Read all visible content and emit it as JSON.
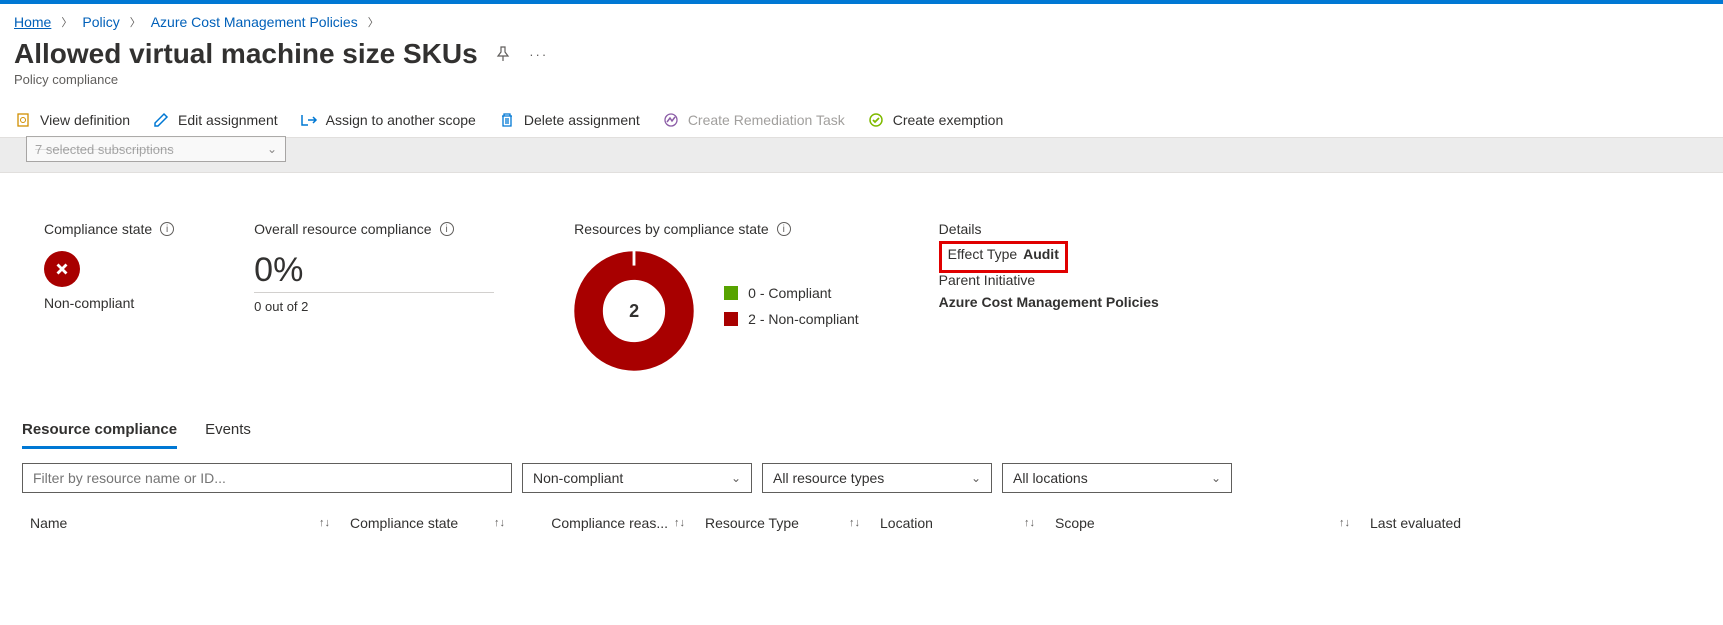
{
  "breadcrumb": {
    "home": "Home",
    "policy": "Policy",
    "parent": "Azure Cost Management Policies"
  },
  "title": "Allowed virtual machine size SKUs",
  "subtitle": "Policy compliance",
  "toolbar": {
    "view_def": "View definition",
    "edit_assign": "Edit assignment",
    "assign_scope": "Assign to another scope",
    "delete_assign": "Delete assignment",
    "create_remediation": "Create Remediation Task",
    "create_exemption": "Create exemption"
  },
  "sub_select_placeholder": "7 selected subscriptions",
  "cards": {
    "compliance_state": {
      "title": "Compliance state",
      "value": "Non-compliant"
    },
    "overall": {
      "title": "Overall resource compliance",
      "pct": "0%",
      "sub": "0 out of 2"
    },
    "by_state": {
      "title": "Resources by compliance state",
      "center": "2",
      "legend_compliant": "0 - Compliant",
      "legend_noncompliant": "2 - Non-compliant"
    },
    "details": {
      "title": "Details",
      "effect_label": "Effect Type",
      "effect_value": "Audit",
      "parent_label": "Parent Initiative",
      "parent_value": "Azure Cost Management Policies"
    }
  },
  "tabs": {
    "resource": "Resource compliance",
    "events": "Events"
  },
  "filters": {
    "placeholder": "Filter by resource name or ID...",
    "compliance": "Non-compliant",
    "resource_types": "All resource types",
    "locations": "All locations"
  },
  "columns": {
    "name": "Name",
    "cs": "Compliance state",
    "cr": "Compliance reas...",
    "rt": "Resource Type",
    "loc": "Location",
    "scope": "Scope",
    "last": "Last evaluated"
  },
  "chart_data": {
    "type": "pie",
    "title": "Resources by compliance state",
    "series": [
      {
        "name": "Compliant",
        "value": 0,
        "color": "#57a300"
      },
      {
        "name": "Non-compliant",
        "value": 2,
        "color": "#a80000"
      }
    ],
    "total": 2
  }
}
